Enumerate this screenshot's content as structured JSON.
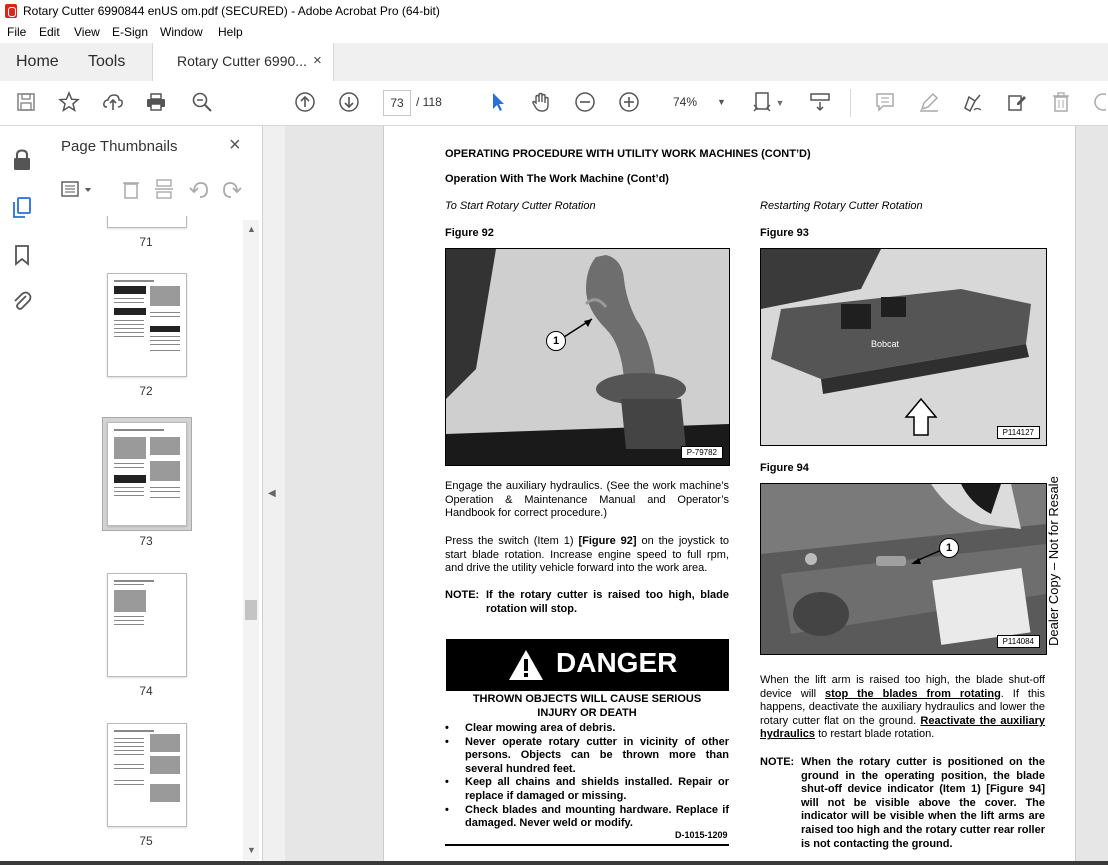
{
  "window": {
    "title": "Rotary Cutter 6990844 enUS om.pdf (SECURED) - Adobe Acrobat Pro (64-bit)"
  },
  "menu": {
    "items": [
      "File",
      "Edit",
      "View",
      "E-Sign",
      "Window",
      "Help"
    ]
  },
  "tabs": {
    "home": "Home",
    "tools": "Tools",
    "document": "Rotary Cutter 6990...",
    "close": "×"
  },
  "toolbar": {
    "current_page": "73",
    "total_pages": "/ 118",
    "zoom": "74%"
  },
  "panel": {
    "title": "Page Thumbnails",
    "close": "×",
    "thumbnails": [
      {
        "label": "71"
      },
      {
        "label": "72"
      },
      {
        "label": "73",
        "selected": true
      },
      {
        "label": "74"
      },
      {
        "label": "75"
      }
    ]
  },
  "document": {
    "heading": "OPERATING PROCEDURE WITH UTILITY WORK MACHINES (CONT’D)",
    "subheading": "Operation With The Work Machine (Cont’d)",
    "left_section": "To Start Rotary Cutter Rotation",
    "right_section": "Restarting Rotary Cutter Rotation",
    "fig92": {
      "label": "Figure 92",
      "code": "P-79782",
      "callout": "1"
    },
    "fig93": {
      "label": "Figure 93",
      "code": "P114127",
      "brand": "Bobcat"
    },
    "fig94": {
      "label": "Figure 94",
      "code": "P114084",
      "callout": "1"
    },
    "para1": "Engage the auxiliary hydraulics. (See the work machine’s Operation & Maintenance Manual and Operator’s Handbook for correct procedure.)",
    "para2_a": "Press the switch (Item 1) ",
    "para2_b": "[Figure 92]",
    "para2_c": " on the joystick to start blade rotation. Increase engine speed to full rpm, and drive the utility vehicle forward into the work area.",
    "note1_label": "NOTE:",
    "note1_text": "If the rotary cutter is raised too high, blade rotation will stop.",
    "danger": {
      "word": "DANGER",
      "headline1": "THROWN OBJECTS WILL CAUSE SERIOUS",
      "headline2": "INJURY OR DEATH",
      "bullets": [
        "Clear mowing area of debris.",
        "Never operate rotary cutter in vicinity of other persons. Objects can be thrown more than several hundred feet.",
        "Keep all chains and shields installed. Repair or replace if damaged or missing.",
        "Check blades and mounting hardware. Replace if damaged. Never weld or modify."
      ],
      "code": "D-1015-1209"
    },
    "right_para_a": "When the lift arm is raised too high, the blade shut-off device will ",
    "right_para_b": "stop the blades from rotating",
    "right_para_c": ". If this happens, deactivate the auxiliary hydraulics and lower the rotary cutter flat on the ground. ",
    "right_para_d": "Reactivate the auxiliary hydraulics",
    "right_para_e": " to restart blade rotation.",
    "note2_label": "NOTE:",
    "note2_text": "When the rotary cutter is positioned on the ground in the operating position, the blade shut-off device indicator (Item 1) [Figure 94] will not be visible above the cover. The indicator will be visible when the lift arms are raised too high and the rotary cutter rear roller is not contacting the ground.",
    "watermark": "Dealer Copy – Not for Resale"
  }
}
